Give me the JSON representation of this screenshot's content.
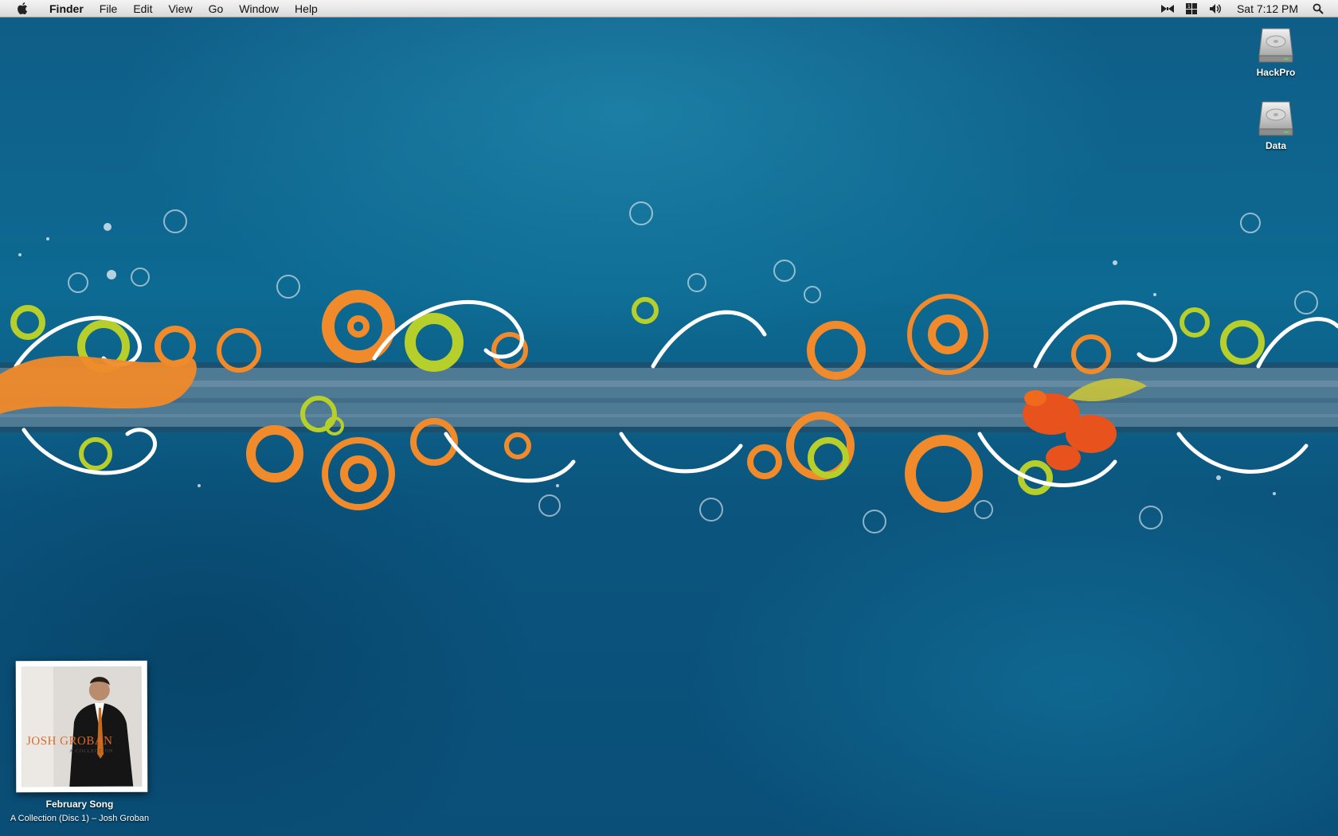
{
  "menubar": {
    "app_name": "Finder",
    "menus": [
      "File",
      "Edit",
      "View",
      "Go",
      "Window",
      "Help"
    ],
    "clock": "Sat 7:12 PM",
    "status_icons": [
      "bluetooth-icon",
      "spaces-icon",
      "volume-icon",
      "spotlight-icon"
    ]
  },
  "desktop": {
    "icons": [
      {
        "label": "HackPro",
        "icon": "hard-drive-icon"
      },
      {
        "label": "Data",
        "icon": "hard-drive-icon"
      }
    ]
  },
  "now_playing": {
    "cover_text": "JOSH GROBAN",
    "cover_subtext": "A COLLECTION",
    "song": "February Song",
    "album_artist": "A Collection (Disc 1) – Josh Groban"
  },
  "colors": {
    "wallpaper": "#0d6a92",
    "band": "#4f7a94",
    "orange": "#f08a2a",
    "lime": "#b6cf2a"
  }
}
